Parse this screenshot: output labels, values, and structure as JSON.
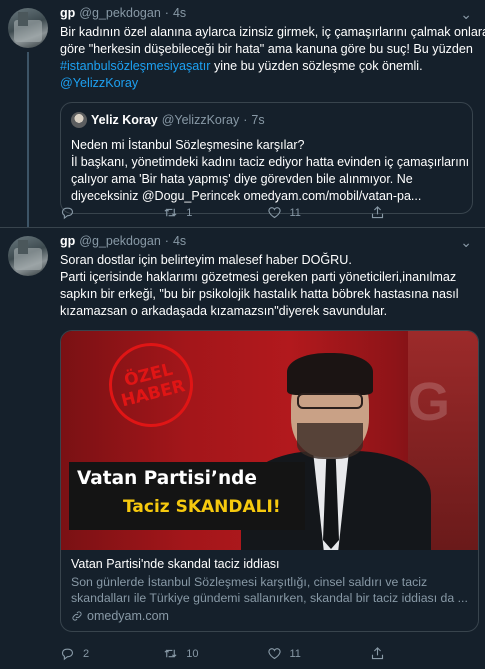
{
  "colors": {
    "background": "#15202b",
    "link": "#1da1f2",
    "muted": "#8899a6",
    "border": "#38444d",
    "stamp": "#e01515",
    "banner_yellow": "#f6c90e"
  },
  "tweet1": {
    "name": "gp",
    "handle": "@g_pekdogan",
    "dot": "·",
    "time": "4s",
    "lines": [
      "Bir kadının özel alanına aylarca izinsiz girmek, iç çamaşırlarını çalmak onlara",
      "göre \"herkesin düşebileceği bir hata\" ama kanuna göre bu suç! Bu yüzden"
    ],
    "hashtag": "#istanbulsözleşmesiyaşatır",
    "line3_rest": " yine bu yüzden sözleşme çok önemli.",
    "mention": "@YelizzKoray",
    "quote": {
      "name": "Yeliz Koray",
      "handle": "@YelizzKoray",
      "dot": "·",
      "time": "7s",
      "lines": [
        "Neden mi İstanbul Sözleşmesine karşılar?",
        "İl başkanı, yönetimdeki kadını taciz ediyor hatta evinden iç çamaşırlarını",
        "çalıyor ama 'Bir hata yapmış' diye görevden bile alınmıyor. Ne",
        "diyeceksiniz @Dogu_Perincek omedyam.com/mobil/vatan-pa..."
      ]
    },
    "actions": {
      "reply": "",
      "retweet": "1",
      "like": "11",
      "share": ""
    }
  },
  "tweet2": {
    "name": "gp",
    "handle": "@g_pekdogan",
    "dot": "·",
    "time": "4s",
    "lines": [
      "Soran dostlar için belirteyim malesef haber DOĞRU.",
      "Parti içerisinde haklarımı gözetmesi gereken parti yöneticileri,inanılmaz",
      "sapkın bir erkeği, \"bu bir psikolojik hastalık hatta böbrek hastasına nasıl",
      "kızamazsan o arkadaşada kızamazsın\"diyerek savundular."
    ],
    "card": {
      "stamp_line1": "ÖZEL",
      "stamp_line2": "HABER",
      "banner_line1": "Vatan Partisi’nde",
      "banner_line2a": "Taciz ",
      "banner_line2b": "SKANDALI!",
      "title": "Vatan Partisi'nde skandal taciz iddiası",
      "desc_lines": [
        "Son günlerde İstanbul Sözleşmesi karşıtlığı, cinsel saldırı ve taciz",
        "skandalları ile Türkiye gündemi sallanırken, skandal bir taciz iddiası da ..."
      ],
      "domain": "omedyam.com"
    },
    "actions": {
      "reply": "2",
      "retweet": "10",
      "like": "11",
      "share": ""
    }
  },
  "icons": {
    "more": "more-icon",
    "reply": "reply-icon",
    "retweet": "retweet-icon",
    "like": "like-icon",
    "share": "share-icon",
    "link": "link-icon"
  }
}
